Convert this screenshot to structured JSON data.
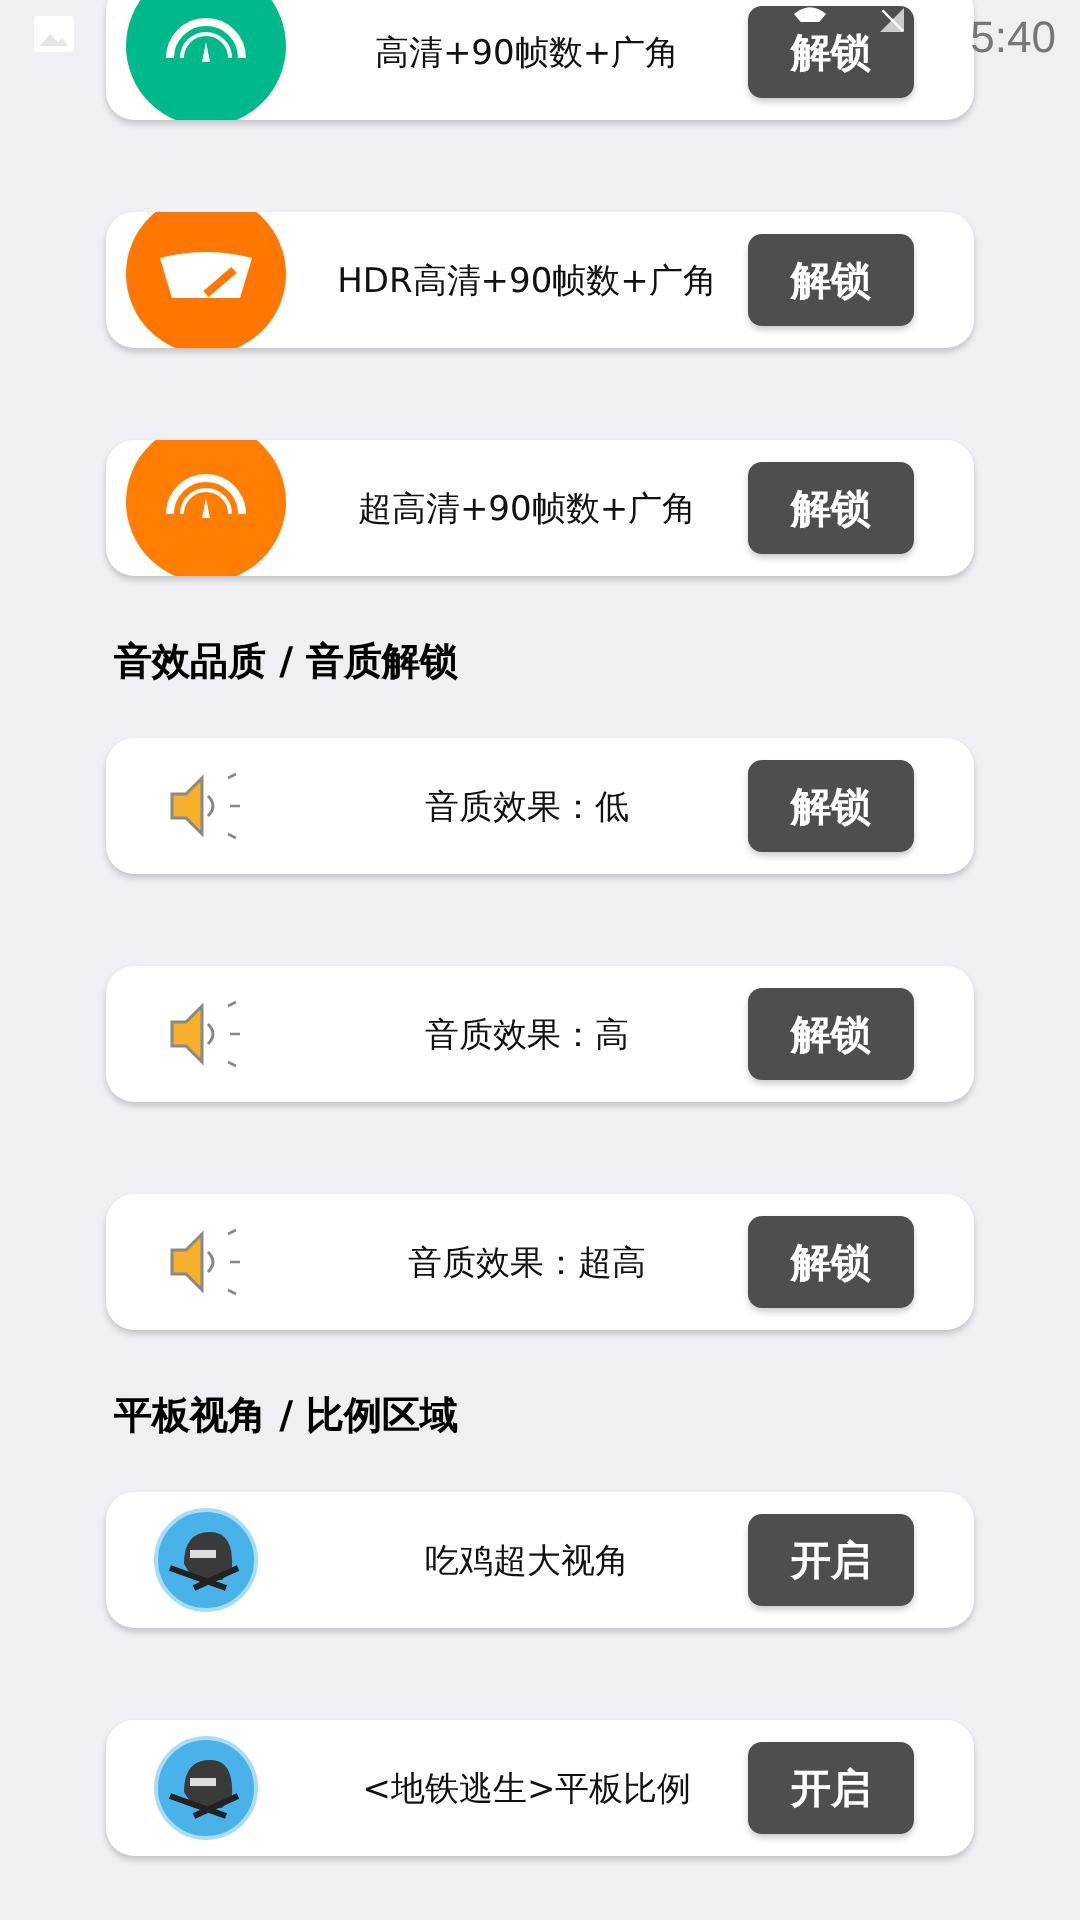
{
  "status_bar": {
    "time": "5:40"
  },
  "sections": [
    {
      "items": [
        {
          "kind": "gauge",
          "color": "#00b98a",
          "label": "高清+90帧数+广角",
          "button": "解锁"
        },
        {
          "kind": "dial",
          "color": "#ff7700",
          "label": "HDR高清+90帧数+广角",
          "button": "解锁"
        },
        {
          "kind": "gauge",
          "color": "#ff7d00",
          "label": "超高清+90帧数+广角",
          "button": "解锁"
        }
      ]
    },
    {
      "title": "音效品质 / 音质解锁",
      "items": [
        {
          "kind": "speaker",
          "label": "音质效果：低",
          "button": "解锁"
        },
        {
          "kind": "speaker",
          "label": "音质效果：高",
          "button": "解锁"
        },
        {
          "kind": "speaker",
          "label": "音质效果：超高",
          "button": "解锁"
        }
      ]
    },
    {
      "title": "平板视角 / 比例区域",
      "items": [
        {
          "kind": "avatar",
          "label": "吃鸡超大视角",
          "button": "开启"
        },
        {
          "kind": "avatar",
          "label": "<地铁逃生>平板比例",
          "button": "开启"
        }
      ]
    }
  ]
}
